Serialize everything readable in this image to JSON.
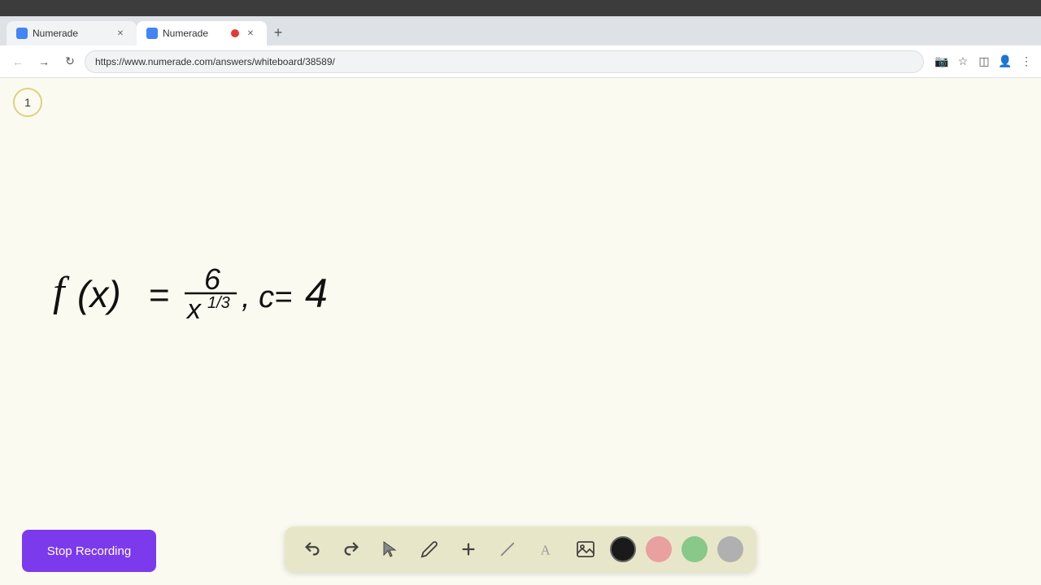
{
  "browser": {
    "tabs": [
      {
        "id": "tab1",
        "label": "Numerade",
        "active": false,
        "recording": false,
        "icon_color": "#4285f4"
      },
      {
        "id": "tab2",
        "label": "Numerade",
        "active": true,
        "recording": true,
        "icon_color": "#4285f4"
      }
    ],
    "new_tab_label": "+",
    "address": "https://www.numerade.com/answers/whiteboard/38589/",
    "nav": {
      "back": "←",
      "forward": "→",
      "refresh": "↻"
    }
  },
  "whiteboard": {
    "page_number": "1",
    "background_color": "#fafaf0"
  },
  "toolbar": {
    "undo_label": "↺",
    "redo_label": "↻",
    "select_label": "▷",
    "pen_label": "✏",
    "add_label": "+",
    "eraser_label": "/",
    "text_label": "A",
    "image_label": "🖼",
    "colors": [
      {
        "name": "black",
        "value": "#1a1a1a"
      },
      {
        "name": "pink",
        "value": "#e8a0a0"
      },
      {
        "name": "green",
        "value": "#88c888"
      },
      {
        "name": "gray",
        "value": "#b0b0b0"
      }
    ]
  },
  "stop_recording": {
    "label": "Stop Recording",
    "bg_color": "#7c3aed"
  }
}
